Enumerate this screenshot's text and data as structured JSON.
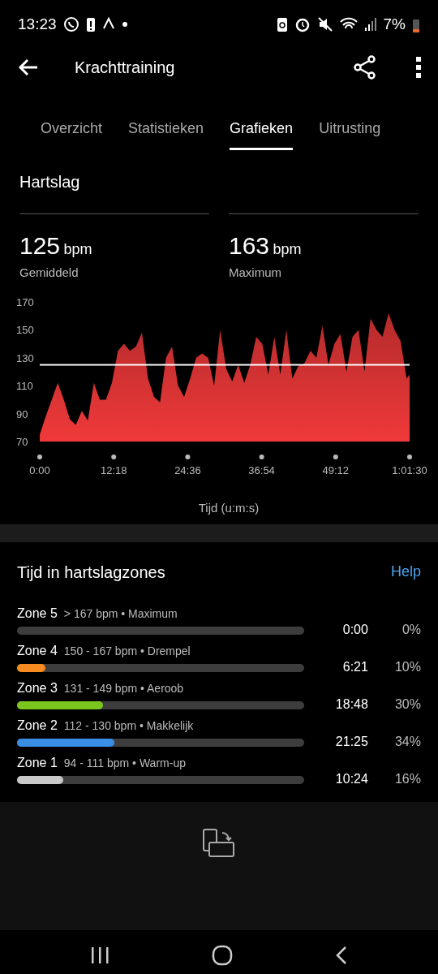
{
  "status_bar": {
    "time": "13:23",
    "battery": "7%"
  },
  "header": {
    "title": "Krachttraining"
  },
  "tabs": [
    {
      "label": "Overzicht",
      "selected": false
    },
    {
      "label": "Statistieken",
      "selected": false
    },
    {
      "label": "Grafieken",
      "selected": true
    },
    {
      "label": "Uitrusting",
      "selected": false
    }
  ],
  "heart_rate": {
    "title": "Hartslag",
    "stats": [
      {
        "value": "125",
        "unit": "bpm",
        "label": "Gemiddeld"
      },
      {
        "value": "163",
        "unit": "bpm",
        "label": "Maximum"
      }
    ],
    "chart_data": {
      "type": "area",
      "xlabel": "Tijd (u:m:s)",
      "x": [
        0,
        1,
        2,
        3,
        4,
        5,
        6,
        7,
        8,
        9,
        10,
        11,
        12,
        13,
        14,
        15,
        16,
        17,
        18,
        19,
        20,
        21,
        22,
        23,
        24,
        25,
        26,
        27,
        28,
        29,
        30,
        31,
        32,
        33,
        34,
        35,
        36,
        37,
        38,
        39,
        40,
        41,
        42,
        43,
        44,
        45,
        46,
        47,
        48,
        49,
        50,
        51,
        52,
        53,
        54,
        55,
        56,
        57,
        58,
        59,
        60,
        61,
        61.5
      ],
      "series": [
        {
          "color": "#f0393a",
          "values": [
            75,
            88,
            100,
            112,
            100,
            86,
            82,
            92,
            85,
            112,
            100,
            100,
            112,
            135,
            140,
            135,
            138,
            148,
            115,
            102,
            98,
            130,
            138,
            110,
            102,
            115,
            130,
            133,
            130,
            110,
            150,
            122,
            113,
            125,
            112,
            125,
            145,
            140,
            118,
            145,
            118,
            150,
            115,
            124,
            126,
            135,
            130,
            153,
            125,
            140,
            147,
            120,
            145,
            150,
            120,
            158,
            150,
            145,
            162,
            150,
            142,
            115,
            118
          ]
        }
      ],
      "xlim": [
        0,
        61.5
      ],
      "ylim": [
        70,
        170
      ],
      "xticks": [
        {
          "value": 0,
          "label": "0:00"
        },
        {
          "value": 12.3,
          "label": "12:18"
        },
        {
          "value": 24.6,
          "label": "24:36"
        },
        {
          "value": 36.9,
          "label": "36:54"
        },
        {
          "value": 49.2,
          "label": "49:12"
        },
        {
          "value": 61.5,
          "label": "1:01:30"
        }
      ],
      "yticks": [
        70,
        90,
        110,
        130,
        150,
        170
      ],
      "ref_lines": [
        {
          "axis": "y",
          "value": 125
        }
      ]
    }
  },
  "zones": {
    "title": "Tijd in hartslagzones",
    "help": "Help",
    "items": [
      {
        "name": "Zone 5",
        "range": "> 167 bpm • Maximum",
        "time": "0:00",
        "percent": "0%"
      },
      {
        "name": "Zone 4",
        "range": "150 - 167 bpm • Drempel",
        "time": "6:21",
        "percent": "10%",
        "level": 0.1,
        "color": "#f68b1f"
      },
      {
        "name": "Zone 3",
        "range": "131 - 149 bpm • Aeroob",
        "time": "18:48",
        "percent": "30%",
        "level": 0.3,
        "color": "#7ac61f"
      },
      {
        "name": "Zone 2",
        "range": "112 - 130 bpm • Makkelijk",
        "time": "21:25",
        "percent": "34%",
        "level": 0.34,
        "color": "#3a8ee6"
      },
      {
        "name": "Zone 1",
        "range": "94 - 111 bpm • Warm-up",
        "time": "10:24",
        "percent": "16%",
        "level": 0.16,
        "color": "#c8c8c8"
      }
    ]
  }
}
